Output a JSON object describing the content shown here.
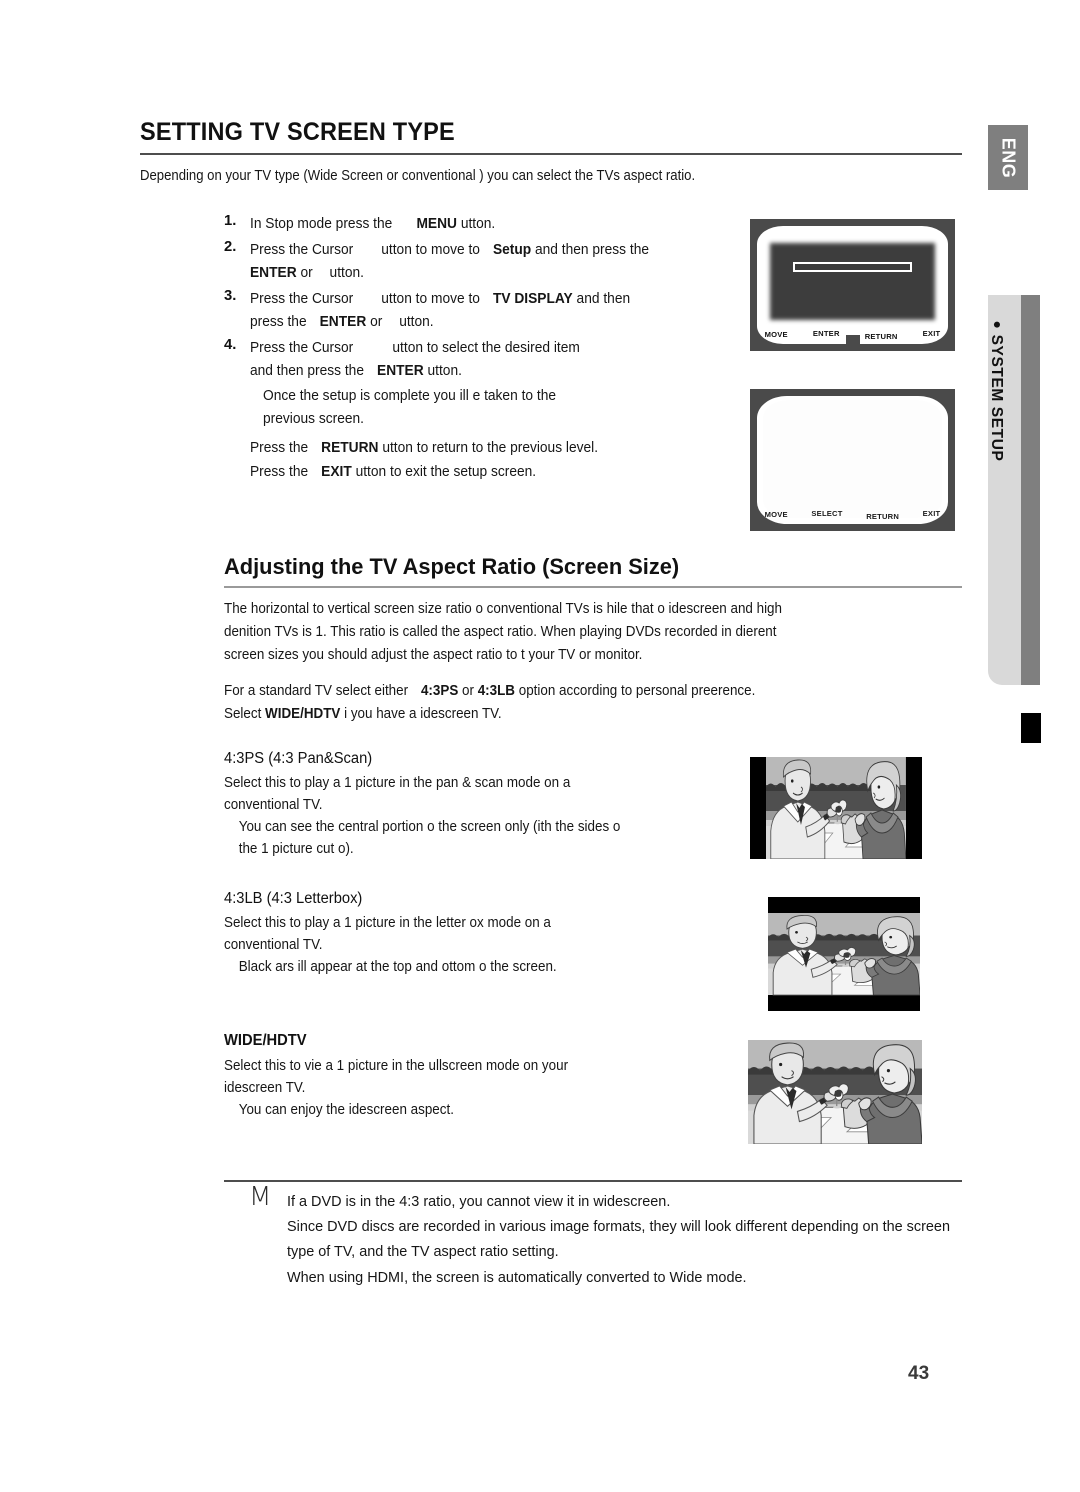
{
  "page": {
    "number": "43",
    "language_tab": "ENG",
    "section_tab": "SYSTEM SETUP",
    "section_tab_bullet": "●"
  },
  "header": {
    "title": "SETTING TV SCREEN TYPE",
    "intro": "Depending on your TV type (Wide Screen or conventional ) you can select the TVs aspect ratio."
  },
  "steps": [
    {
      "num": "1.",
      "lines": [
        [
          {
            "t": "In Stop mode press the",
            "b": false
          },
          {
            "t": "GAP",
            "b": false
          },
          {
            "t": "MENU",
            "b": true
          },
          {
            "t": " utton.",
            "b": false
          }
        ]
      ]
    },
    {
      "num": "2.",
      "lines": [
        [
          {
            "t": "Press the Cursor",
            "b": false
          },
          {
            "t": "GAP",
            "b": false
          },
          {
            "t": " utton to move to",
            "b": false
          },
          {
            "t": "GAPS",
            "b": false
          },
          {
            "t": "Setup",
            "b": true
          },
          {
            "t": " and then press the",
            "b": false
          }
        ],
        [
          {
            "t": "ENTER",
            "b": true
          },
          {
            "t": " or",
            "b": false
          },
          {
            "t": "GAPS",
            "b": false
          },
          {
            "t": " utton.",
            "b": false
          }
        ]
      ]
    },
    {
      "num": "3.",
      "lines": [
        [
          {
            "t": "Press the Cursor",
            "b": false
          },
          {
            "t": "GAP",
            "b": false
          },
          {
            "t": " utton to move to",
            "b": false
          },
          {
            "t": "GAPS",
            "b": false
          },
          {
            "t": "TV DISPLAY",
            "b": true
          },
          {
            "t": " and then",
            "b": false
          }
        ],
        [
          {
            "t": "press the",
            "b": false
          },
          {
            "t": "GAPS",
            "b": false
          },
          {
            "t": "ENTER",
            "b": true
          },
          {
            "t": " or",
            "b": false
          },
          {
            "t": "GAPS",
            "b": false
          },
          {
            "t": " utton.",
            "b": false
          }
        ]
      ]
    },
    {
      "num": "4.",
      "lines": [
        [
          {
            "t": "Press the Cursor",
            "b": false
          },
          {
            "t": "GAPL",
            "b": false
          },
          {
            "t": " utton to select the desired item",
            "b": false
          }
        ],
        [
          {
            "t": "and then press the",
            "b": false
          },
          {
            "t": "GAPS",
            "b": false
          },
          {
            "t": "ENTER",
            "b": true
          },
          {
            "t": " utton.",
            "b": false
          }
        ]
      ],
      "sub": [
        "Once the setup is complete you ill e taken to the",
        "previous screen."
      ]
    }
  ],
  "press_notes": [
    [
      {
        "t": "Press the",
        "b": false
      },
      {
        "t": "GAPS",
        "b": false
      },
      {
        "t": "RETURN",
        "b": true
      },
      {
        "t": " utton to return to the previous level.",
        "b": false
      }
    ],
    [
      {
        "t": "Press the",
        "b": false
      },
      {
        "t": "GAPS",
        "b": false
      },
      {
        "t": "EXIT",
        "b": true
      },
      {
        "t": " utton to exit the setup screen.",
        "b": false
      }
    ]
  ],
  "aspect_section": {
    "title": "Adjusting the TV Aspect Ratio (Screen Size)",
    "ratio_paragraph": [
      "The horizontal to vertical screen size ratio o conventional TVs is  hile that o idescreen and high",
      "denition TVs is 1. This ratio is called the aspect ratio. When playing DVDs recorded in dierent",
      "screen sizes you should adjust the aspect ratio to t your TV or monitor."
    ],
    "standard_paragraph": [
      [
        {
          "t": "For a standard TV select either",
          "b": false
        },
        {
          "t": "GAPS",
          "b": false
        },
        {
          "t": "4:3PS",
          "b": true
        },
        {
          "t": " or ",
          "b": false
        },
        {
          "t": "4:3LB",
          "b": true
        },
        {
          "t": " option according to personal preerence.",
          "b": false
        }
      ],
      [
        {
          "t": "Select ",
          "b": false
        },
        {
          "t": "WIDE/HDTV",
          "b": true
        },
        {
          "t": " i you have a idescreen TV.",
          "b": false
        }
      ]
    ]
  },
  "modes": [
    {
      "title": "4:3PS (4:3 Pan&Scan)",
      "title_bold": false,
      "lines": [
        "Select this to play a 1 picture in the pan & scan mode on a",
        "conventional TV."
      ],
      "indented": [
        "You can see the central portion o the screen only (ith the sides o",
        "the 1 picture cut o)."
      ],
      "image": "couple-toasting-panscan"
    },
    {
      "title": "4:3LB (4:3 Letterbox)",
      "title_bold": false,
      "lines": [
        "Select this to play a 1 picture in the letter ox mode on a",
        "conventional TV."
      ],
      "indented": [
        "Black ars ill appear at the top and ottom o the screen."
      ],
      "image": "couple-toasting-letterbox"
    },
    {
      "title": "WIDE/HDTV",
      "title_bold": true,
      "lines": [
        "Select this to vie a 1 picture in the ullscreen mode on your",
        "idescreen TV."
      ],
      "indented": [
        "You can enjoy the idescreen aspect."
      ],
      "image": "couple-toasting-widescreen"
    }
  ],
  "note": {
    "marker": "M",
    "lines": [
      "If a DVD is in the 4:3 ratio, you cannot view it in widescreen.",
      "Since DVD discs are recorded in various image formats, they will look different depending on the screen",
      "type of TV, and the TV aspect ratio setting.",
      "When using HDMI, the screen is automatically converted to Wide mode."
    ]
  },
  "tv_screens": [
    {
      "name": "menu-screen-dark",
      "footer": [
        "MOVE",
        "ENTER",
        "RETURN",
        "EXIT"
      ]
    },
    {
      "name": "setup-screen-blank",
      "footer": [
        "MOVE",
        "SELECT",
        "RETURN",
        "EXIT"
      ]
    }
  ]
}
